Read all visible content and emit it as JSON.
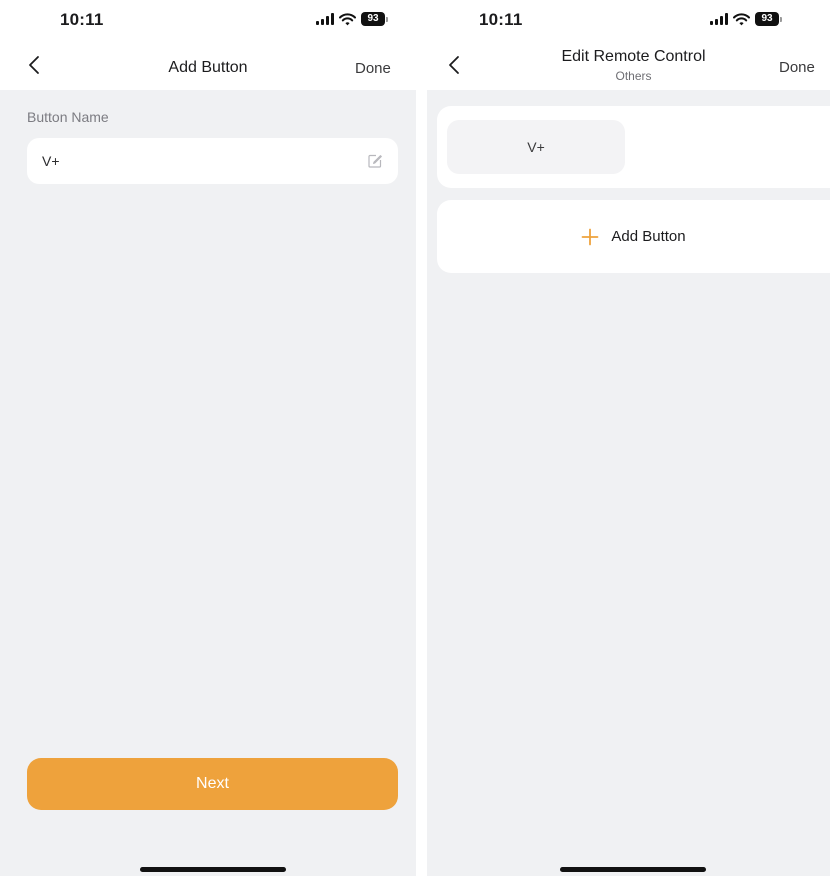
{
  "screens": [
    {
      "status": {
        "time": "10:11",
        "battery": "93"
      },
      "nav": {
        "title": "Add Button",
        "done": "Done"
      },
      "form": {
        "label": "Button Name",
        "value": "V+"
      },
      "next_label": "Next"
    },
    {
      "status": {
        "time": "10:11",
        "battery": "93"
      },
      "nav": {
        "title": "Edit Remote Control",
        "subtitle": "Others",
        "done": "Done"
      },
      "buttons": [
        {
          "label": "V+"
        }
      ],
      "add_label": "Add Button"
    }
  ],
  "colors": {
    "accent": "#eea23c",
    "background": "#f0f1f3",
    "card": "#ffffff"
  },
  "icons": [
    "back-chevron-icon",
    "edit-icon",
    "plus-icon",
    "signal-icon",
    "wifi-icon",
    "battery-icon"
  ]
}
